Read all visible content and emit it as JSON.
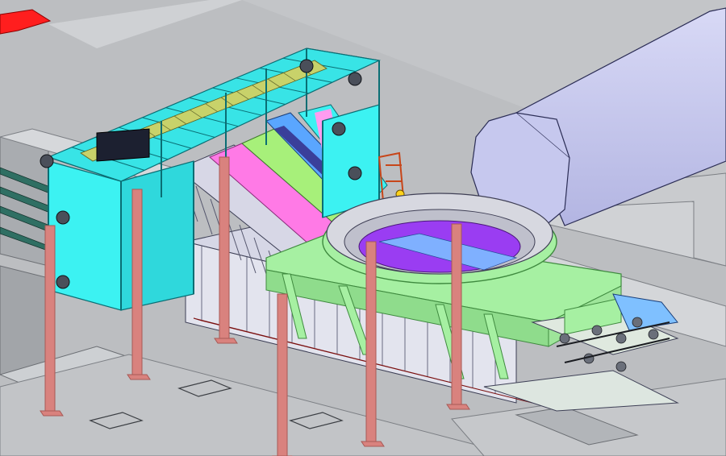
{
  "scene": {
    "kind": "3D CAD isometric model render",
    "colors": {
      "floor": "#bfc1c4",
      "floor_dark": "#a6a9ad",
      "floor_light": "#d3d5d8",
      "frame": "#39e6e6",
      "frame_line": "#0a6e74",
      "panel_cyan": "#3cf2f2",
      "walkway": "#c8d26a",
      "column": "#d9827e",
      "column_dark": "#a85955",
      "ring_frame": "#a6f0a2",
      "ring_line": "#3f8a3f",
      "ring_inner": "#cfcfd8",
      "pit_purple": "#9a3df2",
      "pit_blue": "#7fb0ff",
      "conveyor_blue": "#5aa6ff",
      "conveyor_navy": "#3a3f9a",
      "chute_magenta": "#ff7ae6",
      "chute_grey": "#d7d7e6",
      "cylinder": "#c9cbef",
      "cylinder_line": "#2b2d55",
      "red_marker": "#ff1e1e",
      "rail_green": "#2f6f63",
      "motor_black": "#1c2030",
      "orange": "#ff7d1a",
      "worker": "#ffd21a"
    }
  }
}
